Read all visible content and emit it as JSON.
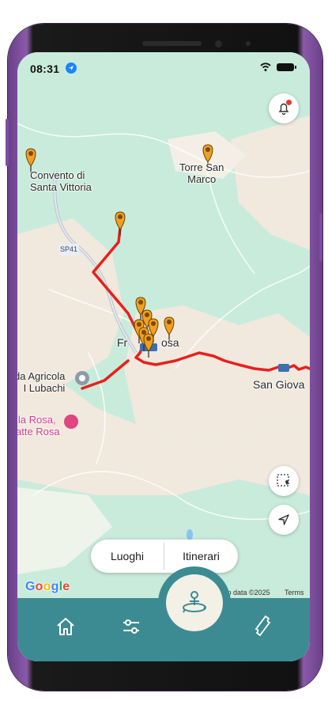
{
  "status_bar": {
    "time": "08:31"
  },
  "map": {
    "labels": {
      "convento": "Convento di\nSanta Vittoria",
      "torre": "Torre San\nMarco",
      "town": "Fr",
      "town_tail": "osa",
      "agricola": "da Agricola\nI Lubachi",
      "san_giova": "San Giova",
      "road_shield": "SP41",
      "bella_rosa": "lla Rosa,\natte Rosa"
    },
    "route_color": "#e8201c",
    "marker_color": "#f0a020"
  },
  "segmented": {
    "places_label": "Luoghi",
    "itineraries_label": "Itinerari"
  },
  "attribution": {
    "google": "Google",
    "data": "Map data ©2025",
    "terms": "Terms"
  },
  "nav": {
    "items": [
      "home-icon",
      "sliders-icon",
      "explore-icon",
      "ticket-icon"
    ],
    "background": "#3d8b92"
  },
  "colors": {
    "map_green": "#c9ebdc",
    "map_beige": "#f1e9dd",
    "accent": "#1b84ff"
  }
}
